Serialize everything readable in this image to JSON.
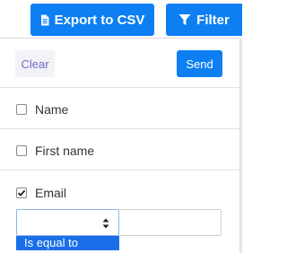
{
  "toolbar": {
    "export_label": "Export to CSV",
    "filter_label": "Filter"
  },
  "panel": {
    "clear_label": "Clear",
    "send_label": "Send",
    "fields": [
      {
        "label": "Name",
        "checked": false
      },
      {
        "label": "First name",
        "checked": false
      },
      {
        "label": "Email",
        "checked": true
      }
    ],
    "email_filter": {
      "operator_value": "",
      "value": "",
      "dropdown_option": "Is equal to"
    }
  },
  "colors": {
    "primary": "#0d7ff2",
    "clear_text": "#6e69c9",
    "clear_bg": "#f2f2f7",
    "dropdown_highlight": "#1a6fe8"
  },
  "icons": {
    "export": "file-csv-icon",
    "filter": "funnel-icon",
    "check": "checkmark-icon",
    "select_arrows": "sort-arrows-icon"
  }
}
